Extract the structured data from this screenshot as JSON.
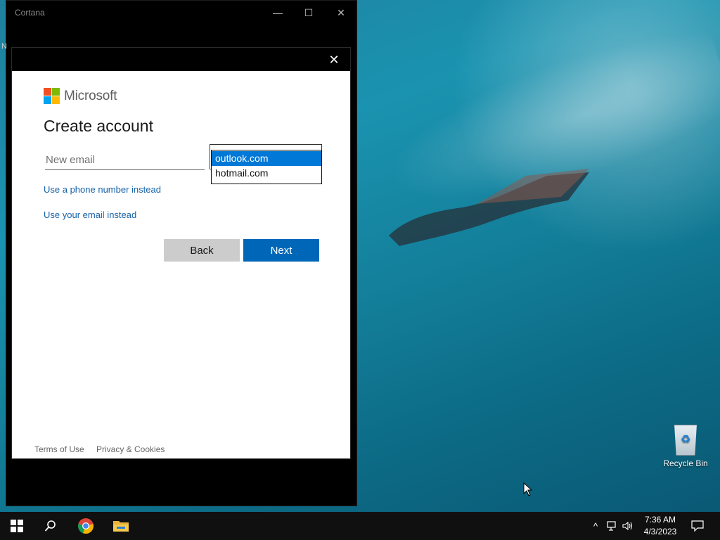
{
  "window": {
    "title": "Cortana",
    "edge_letter": "N"
  },
  "dialog": {
    "brand": "Microsoft",
    "heading": "Create account",
    "email_placeholder": "New email",
    "domain_options": [
      "outlook.com",
      "hotmail.com"
    ],
    "domain_selected": "outlook.com",
    "links": {
      "phone": "Use a phone number instead",
      "email": "Use your email instead"
    },
    "buttons": {
      "back": "Back",
      "next": "Next"
    },
    "footer": {
      "terms": "Terms of Use",
      "privacy": "Privacy & Cookies"
    }
  },
  "desktop": {
    "recycle_bin_label": "Recycle Bin"
  },
  "taskbar": {
    "time": "7:36 AM",
    "date": "4/3/2023"
  },
  "colors": {
    "accent": "#0067b8",
    "link": "#1562a8",
    "ms_red": "#f25022",
    "ms_green": "#7fba00",
    "ms_blue": "#00a4ef",
    "ms_yellow": "#ffb900"
  }
}
